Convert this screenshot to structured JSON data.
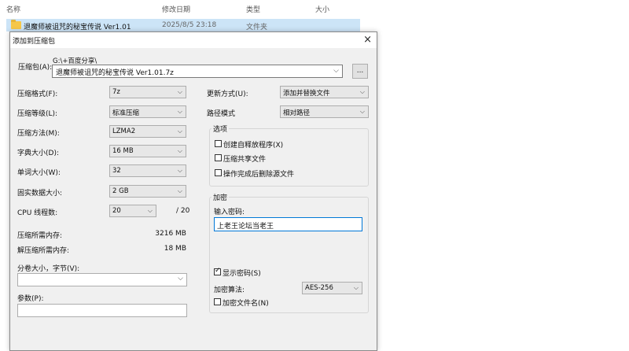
{
  "explorer": {
    "columns": {
      "name": "名称",
      "modified": "修改日期",
      "type": "类型",
      "size": "大小"
    },
    "sort_indicator": "^",
    "selected_item": {
      "name": "退魔师被诅咒的秘宝传说 Ver1.01",
      "date": "2025/8/5 23:18",
      "type": "文件夹"
    }
  },
  "dialog": {
    "title": "添加到压缩包",
    "close": "×",
    "archive": {
      "label": "压缩包(A):",
      "path": "G:\\+百度分享\\",
      "filename": "退魔师被诅咒的秘宝传说 Ver1.01.7z",
      "browse": "..."
    },
    "left": [
      {
        "label": "压缩格式(F):",
        "value": "7z"
      },
      {
        "label": "压缩等级(L):",
        "value": "标准压缩"
      },
      {
        "label": "压缩方法(M):",
        "value": "LZMA2"
      },
      {
        "label": "字典大小(D):",
        "value": "16 MB"
      },
      {
        "label": "单词大小(W):",
        "value": "32"
      },
      {
        "label": "固实数据大小:",
        "value": "2 GB"
      }
    ],
    "cpu": {
      "label": "CPU 线程数:",
      "value": "20",
      "max": "/ 20"
    },
    "memory": [
      {
        "label": "压缩所需内存:",
        "value": "3216 MB"
      },
      {
        "label": "解压缩所需内存:",
        "value": "18 MB"
      }
    ],
    "split": {
      "label": "分卷大小，字节(V):",
      "value": ""
    },
    "params": {
      "label": "参数(P):",
      "value": ""
    },
    "update_mode": {
      "label": "更新方式(U):",
      "value": "添加并替换文件"
    },
    "path_mode": {
      "label": "路径模式",
      "value": "相对路径"
    },
    "options": {
      "title": "选项",
      "items": [
        {
          "label": "创建自释放程序(X)",
          "checked": false
        },
        {
          "label": "压缩共享文件",
          "checked": false
        },
        {
          "label": "操作完成后删除源文件",
          "checked": false
        }
      ]
    },
    "encryption": {
      "title": "加密",
      "password_label": "输入密码:",
      "password": "上老王论坛当老王",
      "show_password": {
        "label": "显示密码(S)",
        "checked": true
      },
      "method_label": "加密算法:",
      "method": "AES-256",
      "encrypt_names": {
        "label": "加密文件名(N)",
        "checked": false
      }
    }
  }
}
